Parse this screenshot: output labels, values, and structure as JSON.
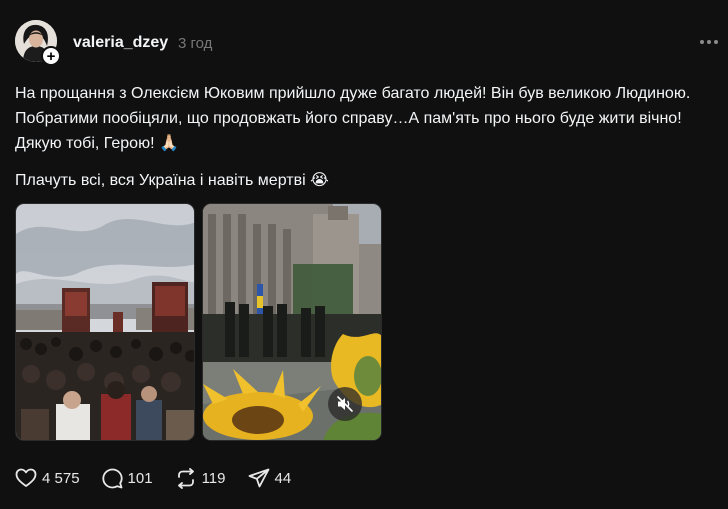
{
  "post": {
    "username": "valeria_dzey",
    "timestamp": "3 год",
    "text_1": "На прощання з Олексієм Юковим прийшло дуже багато людей! Він був великою Людиною. Побратими пообіцяли, що продовжать його справу…А пам'ять про нього буде жити вічно! Дякую тобі, Герою! 🙏🏻",
    "text_2": "Плачуть всі, вся Україна і навіть мертві 😭",
    "follow_symbol": "+"
  },
  "actions": {
    "likes": "4 575",
    "comments": "101",
    "reposts": "119",
    "shares": "44"
  },
  "icons": {
    "more": "more-icon",
    "like": "heart-icon",
    "comment": "comment-icon",
    "repost": "repost-icon",
    "share": "share-icon",
    "mute": "muted-speaker-icon"
  },
  "colors": {
    "background": "#101010",
    "text": "#f3f5f7",
    "muted": "#777777"
  }
}
